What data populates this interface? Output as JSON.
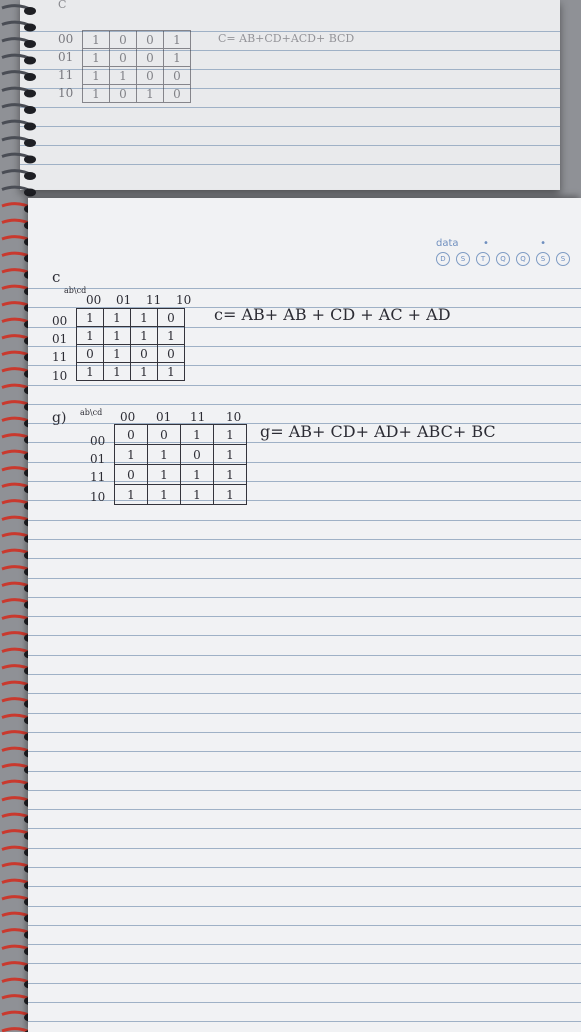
{
  "notebook": {
    "back_page": {
      "top_map_note": "C",
      "rows": [
        "00",
        "01",
        "11",
        "10"
      ],
      "cells": [
        [
          "1",
          "0",
          "0",
          "1"
        ],
        [
          "1",
          "0",
          "0",
          "1"
        ],
        [
          "1",
          "1",
          "0",
          "0"
        ],
        [
          "1",
          "0",
          "1",
          "0"
        ]
      ],
      "expression": "C= AB+CD+ACD+ BCD"
    },
    "front_page": {
      "date_label": "data",
      "date_dots": "• •",
      "date_circles": [
        "D",
        "S",
        "T",
        "Q",
        "Q",
        "S",
        "S"
      ],
      "map1": {
        "label": "c",
        "corner": "ab\\cd",
        "cols": [
          "00",
          "01",
          "11",
          "10"
        ],
        "rows": [
          "00",
          "01",
          "11",
          "10"
        ],
        "cells": [
          [
            "1",
            "1",
            "1",
            "0"
          ],
          [
            "1",
            "1",
            "1",
            "1"
          ],
          [
            "0",
            "1",
            "0",
            "0"
          ],
          [
            "1",
            "1",
            "1",
            "1"
          ]
        ],
        "expression": "c= AB+ AB + CD + AC + AD"
      },
      "map2": {
        "label": "g)",
        "corner": "ab\\cd",
        "cols": [
          "00",
          "01",
          "11",
          "10"
        ],
        "rows": [
          "00",
          "01",
          "11",
          "10"
        ],
        "cells": [
          [
            "0",
            "0",
            "1",
            "1"
          ],
          [
            "1",
            "1",
            "0",
            "1"
          ],
          [
            "0",
            "1",
            "1",
            "1"
          ],
          [
            "1",
            "1",
            "1",
            "1"
          ]
        ],
        "expression": "g= AB+ CD+ AD+ ABC+ BC"
      }
    }
  }
}
